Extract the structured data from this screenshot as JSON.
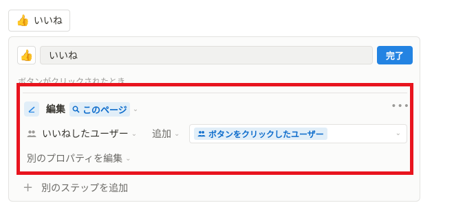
{
  "top_button": {
    "emoji": "👍",
    "label": "いいね"
  },
  "panel": {
    "emoji": "👍",
    "name_value": "いいね",
    "done_label": "完了",
    "section_label": "ボタンがクリックされたとき"
  },
  "step": {
    "action_label": "編集",
    "target_label": "このページ",
    "more": "•••",
    "property_label": "いいねしたユーザー",
    "operation_label": "追加",
    "value_label": "ボタンをクリックしたユーザー",
    "other_property_label": "別のプロパティを編集"
  },
  "add_step_label": "別のステップを追加",
  "colors": {
    "accent": "#2383e2",
    "highlight_border": "#e8141e",
    "pill_bg": "#e1eef8"
  }
}
